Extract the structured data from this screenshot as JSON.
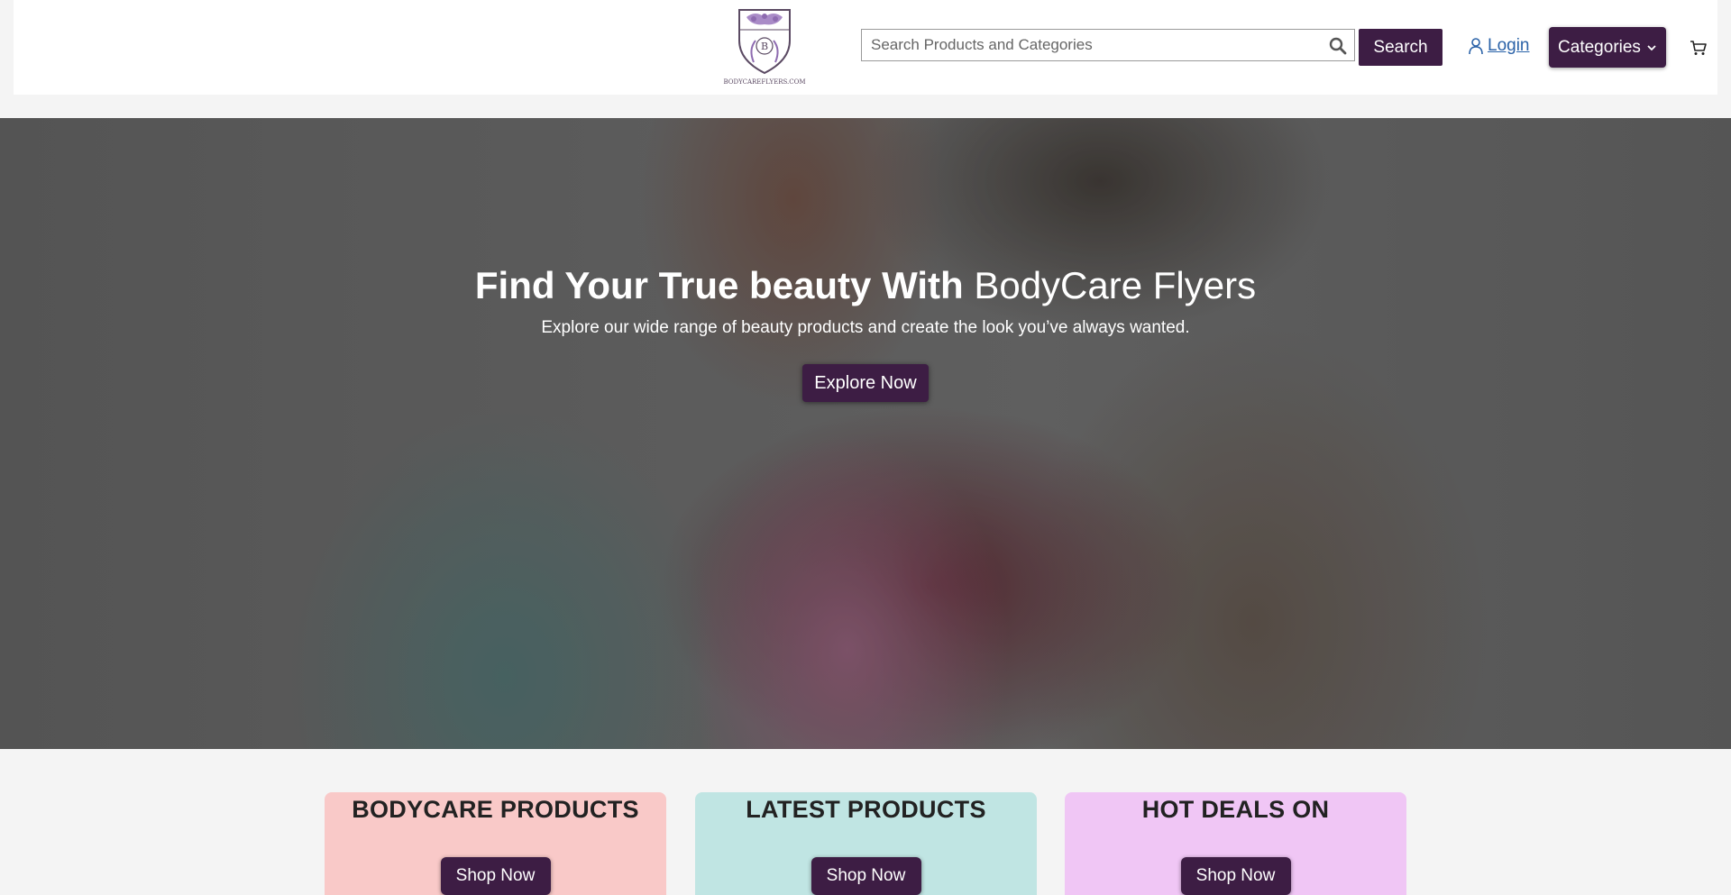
{
  "header": {
    "logo_name": "logo-icon",
    "logo_letter": "B",
    "logo_caption": "BODYCAREFLYERS.COM",
    "search": {
      "placeholder": "Search Products and Categories",
      "value": "",
      "button_label": "Search"
    },
    "login_label": "Login",
    "categories_label": "Categories",
    "cart_icon": "cart-icon"
  },
  "hero": {
    "title_bold": "Find Your True beauty With",
    "title_light": "BodyCare Flyers",
    "subtitle": "Explore our wide range of beauty products and create the look you’ve always wanted.",
    "button_label": "Explore Now"
  },
  "cards": [
    {
      "title": "BODYCARE PRODUCTS",
      "button_label": "Shop Now",
      "color": "#f9c9c8"
    },
    {
      "title": "LATEST PRODUCTS",
      "button_label": "Shop Now",
      "color": "#c0e5e3"
    },
    {
      "title": "HOT DEALS ON",
      "button_label": "Shop Now",
      "color": "#f0c6f5"
    }
  ],
  "colors": {
    "brand": "#3d1d44",
    "link": "#2a62a8"
  }
}
